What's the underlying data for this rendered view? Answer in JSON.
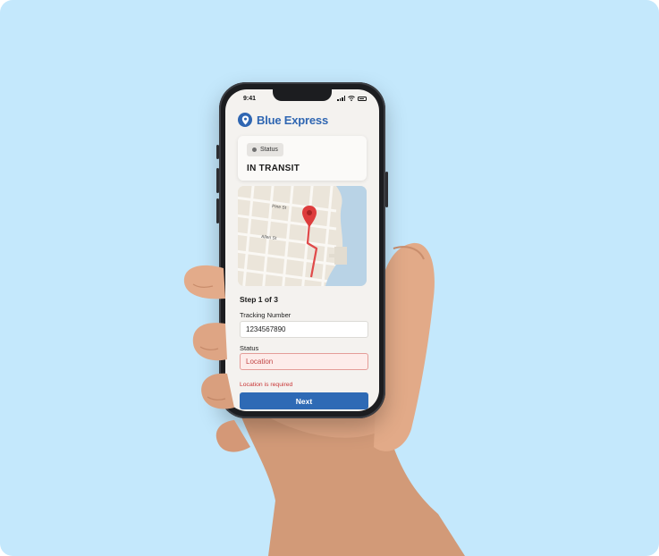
{
  "device": {
    "status_bar": {
      "time": "9:41"
    }
  },
  "app": {
    "brand_name": "Blue Express",
    "brand_icon": "location-pin-icon",
    "accent_color": "#2f66b2"
  },
  "status_card": {
    "chip_label": "Status",
    "value": "IN TRANSIT"
  },
  "map": {
    "streets": [
      "Pine St",
      "Allen St"
    ],
    "marker_icon": "location-pin-icon",
    "route_color": "#e04a4a",
    "water_color": "#b9d3e6"
  },
  "form": {
    "step_label": "Step 1 of 3",
    "tracking_label": "Tracking Number",
    "tracking_value": "1234567890",
    "status_label": "Status",
    "status_placeholder": "Location",
    "status_error": "Location is required",
    "error_color": "#c83434",
    "next_label": "Next",
    "button_color": "#2e6ab5"
  }
}
